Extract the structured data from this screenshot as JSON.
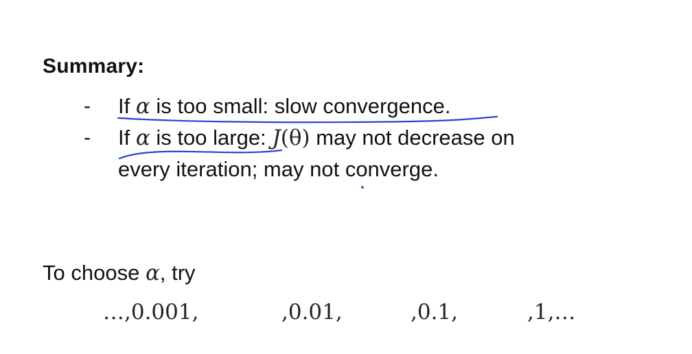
{
  "summary": {
    "heading": "Summary:",
    "bullets": [
      {
        "dash": "-",
        "prefix": "If",
        "symbol": "α",
        "text": "is too small: slow convergence."
      },
      {
        "dash": "-",
        "prefix": "If",
        "symbol": "α",
        "text": "is too large:",
        "cost_fn": "J",
        "cost_arg": "(θ)",
        "rest": "may not decrease on",
        "continuation": "every iteration; may not converge."
      }
    ]
  },
  "choose": {
    "prefix": "To choose",
    "symbol": "α",
    "suffix": ", try"
  },
  "sequence": [
    "…,0.001,",
    ",0.01,",
    ",0.1,",
    ",1,…"
  ],
  "colors": {
    "ink": "#2a3fd0",
    "text": "#111111"
  }
}
